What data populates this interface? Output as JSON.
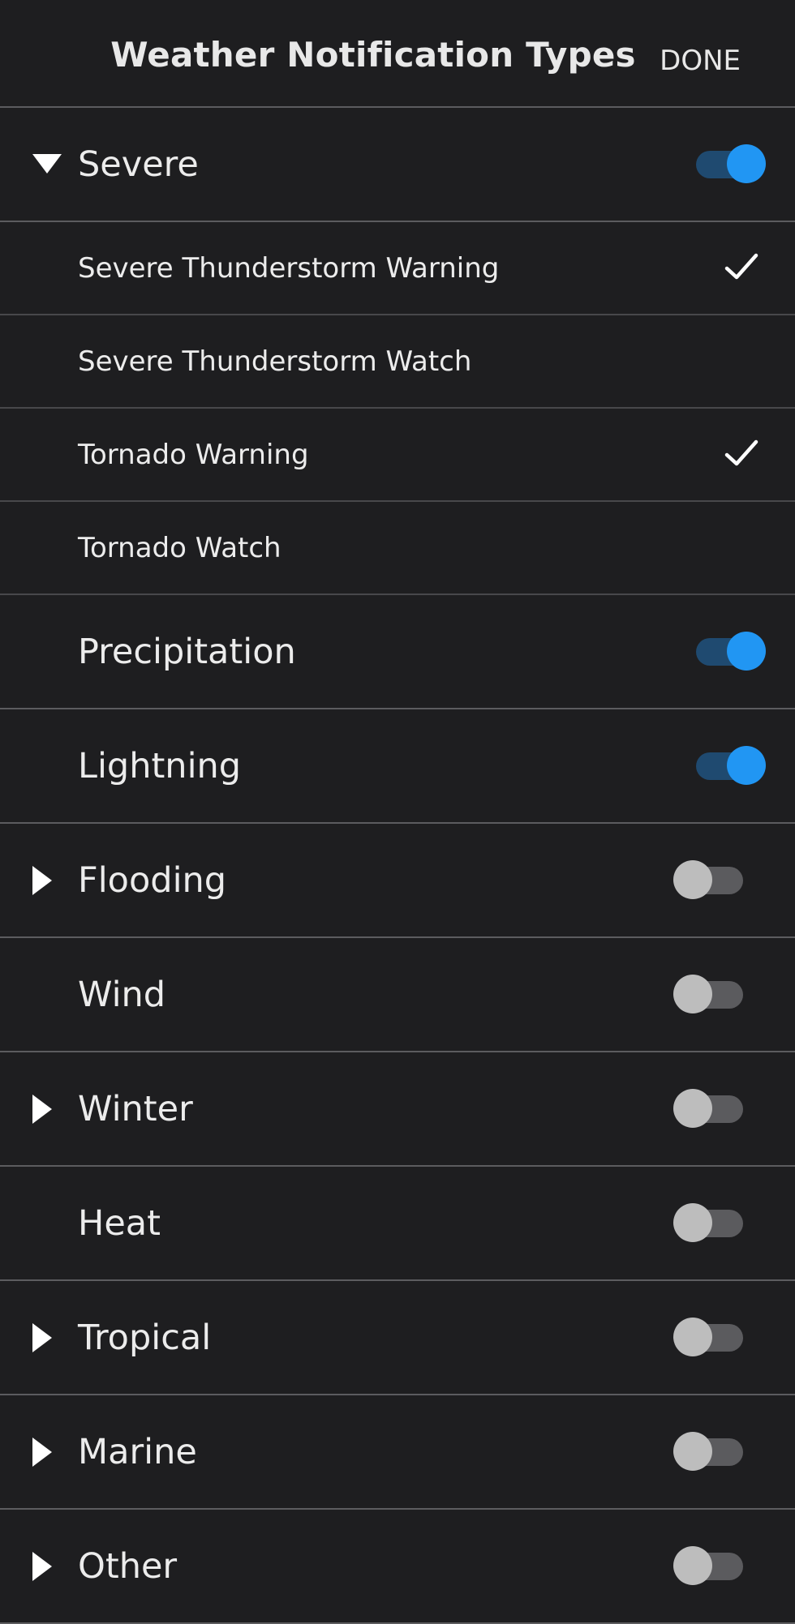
{
  "header": {
    "title": "Weather Notification Types",
    "done_label": "DONE"
  },
  "colors": {
    "background": "#1e1e20",
    "divider": "#5c5c5f",
    "toggle_on": "#2196f3",
    "toggle_off": "#bdbdbd"
  },
  "rows": [
    {
      "type": "group",
      "label": "Severe",
      "expander": "expanded",
      "enabled": true
    },
    {
      "type": "sub",
      "label": "Severe Thunderstorm Warning",
      "checked": true
    },
    {
      "type": "sub",
      "label": "Severe Thunderstorm Watch",
      "checked": false
    },
    {
      "type": "sub",
      "label": "Tornado Warning",
      "checked": true
    },
    {
      "type": "sub",
      "label": "Tornado Watch",
      "checked": false
    },
    {
      "type": "group",
      "label": "Precipitation",
      "expander": "none",
      "enabled": true
    },
    {
      "type": "group",
      "label": "Lightning",
      "expander": "none",
      "enabled": true
    },
    {
      "type": "group",
      "label": "Flooding",
      "expander": "collapsed",
      "enabled": false
    },
    {
      "type": "group",
      "label": "Wind",
      "expander": "none",
      "enabled": false
    },
    {
      "type": "group",
      "label": "Winter",
      "expander": "collapsed",
      "enabled": false
    },
    {
      "type": "group",
      "label": "Heat",
      "expander": "none",
      "enabled": false
    },
    {
      "type": "group",
      "label": "Tropical",
      "expander": "collapsed",
      "enabled": false
    },
    {
      "type": "group",
      "label": "Marine",
      "expander": "collapsed",
      "enabled": false
    },
    {
      "type": "group",
      "label": "Other",
      "expander": "collapsed",
      "enabled": false
    }
  ]
}
